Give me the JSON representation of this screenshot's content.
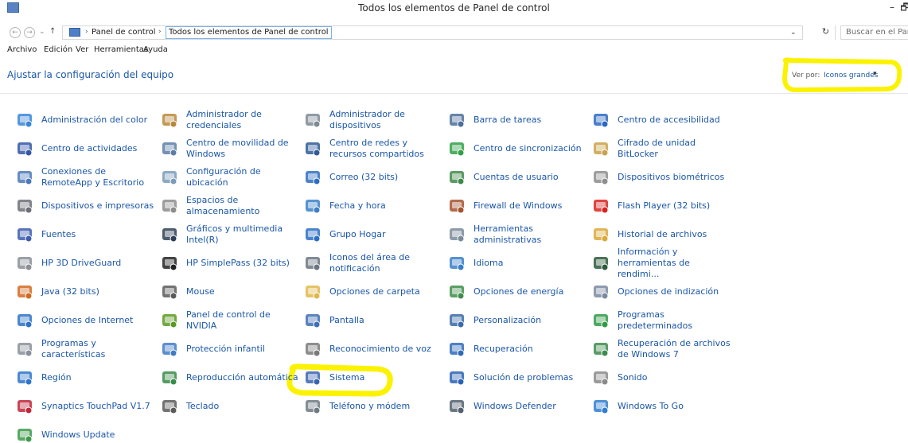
{
  "window": {
    "title": "Todos los elementos de Panel de control",
    "minimize_glyph": "–",
    "maximize_glyph": "🗗"
  },
  "address": {
    "back_glyph": "←",
    "forward_glyph": "→",
    "history_glyph": "⌄",
    "up_glyph": "↑",
    "crumbs": [
      "Panel de control",
      "Todos los elementos de Panel de control"
    ],
    "separator": "›",
    "dropdown_glyph": "⌄",
    "refresh_glyph": "↻",
    "search_placeholder": "Buscar en el Pane..."
  },
  "menu": [
    "Archivo",
    "Edición",
    "Ver",
    "Herramientas",
    "Ayuda"
  ],
  "header": {
    "title": "Ajustar la configuración del equipo",
    "view_by_label": "Ver por:",
    "view_by_value": "Iconos grandes",
    "view_by_arrow": "▾"
  },
  "highlight_color": "#fbf200",
  "link_color": "#1a56a8",
  "items": [
    {
      "label": "Administración del color",
      "icon": "color-management-icon",
      "color": "#3a86d8"
    },
    {
      "label": "Administrador de credenciales",
      "icon": "credential-manager-icon",
      "color": "#b8883a"
    },
    {
      "label": "Administrador de dispositivos",
      "icon": "device-manager-icon",
      "color": "#7d8a96"
    },
    {
      "label": "Barra de tareas",
      "icon": "taskbar-icon",
      "color": "#4a6f9a"
    },
    {
      "label": "Centro de accesibilidad",
      "icon": "accessibility-icon",
      "color": "#2a69c2"
    },
    {
      "label": "Centro de actividades",
      "icon": "action-center-flag-icon",
      "color": "#3357a6"
    },
    {
      "label": "Centro de movilidad de Windows",
      "icon": "mobility-center-icon",
      "color": "#5c7da6"
    },
    {
      "label": "Centro de redes y recursos compartidos",
      "icon": "network-center-icon",
      "color": "#2e5a96"
    },
    {
      "label": "Centro de sincronización",
      "icon": "sync-center-icon",
      "color": "#2fa046"
    },
    {
      "label": "Cifrado de unidad BitLocker",
      "icon": "bitlocker-key-icon",
      "color": "#c9a24a"
    },
    {
      "label": "Conexiones de RemoteApp y Escritorio",
      "icon": "remoteapp-icon",
      "color": "#4b78b8"
    },
    {
      "label": "Configuración de ubicación",
      "icon": "location-settings-icon",
      "color": "#7a9bb9"
    },
    {
      "label": "Correo (32 bits)",
      "icon": "mail-icon",
      "color": "#2f6dbf"
    },
    {
      "label": "Cuentas de usuario",
      "icon": "user-accounts-icon",
      "color": "#3f8a4a"
    },
    {
      "label": "Dispositivos biométricos",
      "icon": "biometric-icon",
      "color": "#8d8d8d"
    },
    {
      "label": "Dispositivos e impresoras",
      "icon": "devices-printers-icon",
      "color": "#6b6f77"
    },
    {
      "label": "Espacios de almacenamiento",
      "icon": "storage-spaces-icon",
      "color": "#8c8c8c"
    },
    {
      "label": "Fecha y hora",
      "icon": "date-time-icon",
      "color": "#3a7fc8"
    },
    {
      "label": "Firewall de Windows",
      "icon": "firewall-icon",
      "color": "#a5522d"
    },
    {
      "label": "Flash Player (32 bits)",
      "icon": "flash-player-icon",
      "color": "#d9231e"
    },
    {
      "label": "Fuentes",
      "icon": "fonts-icon",
      "color": "#3d5db0"
    },
    {
      "label": "Gráficos y multimedia Intel(R)",
      "icon": "intel-graphics-icon",
      "color": "#2f3f55"
    },
    {
      "label": "Grupo Hogar",
      "icon": "homegroup-icon",
      "color": "#2b6fc4"
    },
    {
      "label": "Herramientas administrativas",
      "icon": "admin-tools-icon",
      "color": "#7b8a99"
    },
    {
      "label": "Historial de archivos",
      "icon": "file-history-icon",
      "color": "#d9a93a"
    },
    {
      "label": "HP 3D DriveGuard",
      "icon": "hp-driveguard-icon",
      "color": "#8a8f96"
    },
    {
      "label": "HP SimplePass (32 bits)",
      "icon": "hp-simplepass-icon",
      "color": "#222222"
    },
    {
      "label": "Iconos del área de notificación",
      "icon": "notification-area-icon",
      "color": "#6a7580"
    },
    {
      "label": "Idioma",
      "icon": "language-globe-icon",
      "color": "#3a7ec8"
    },
    {
      "label": "Información y herramientas de rendimi...",
      "icon": "performance-icon",
      "color": "#2c5a3a"
    },
    {
      "label": "Java (32 bits)",
      "icon": "java-icon",
      "color": "#d2691e"
    },
    {
      "label": "Mouse",
      "icon": "mouse-icon",
      "color": "#5a5a5a"
    },
    {
      "label": "Opciones de carpeta",
      "icon": "folder-options-icon",
      "color": "#e0b84a"
    },
    {
      "label": "Opciones de energía",
      "icon": "power-options-icon",
      "color": "#3e8e4a"
    },
    {
      "label": "Opciones de indización",
      "icon": "indexing-options-icon",
      "color": "#7a8aa0"
    },
    {
      "label": "Opciones de Internet",
      "icon": "internet-options-icon",
      "color": "#2e72c6"
    },
    {
      "label": "Panel de control de NVIDIA",
      "icon": "nvidia-icon",
      "color": "#5a9a22"
    },
    {
      "label": "Pantalla",
      "icon": "display-icon",
      "color": "#3f6fb3"
    },
    {
      "label": "Personalización",
      "icon": "personalization-icon",
      "color": "#3a6aa8"
    },
    {
      "label": "Programas predeterminados",
      "icon": "default-programs-icon",
      "color": "#2f9a48"
    },
    {
      "label": "Programas y características",
      "icon": "programs-features-icon",
      "color": "#8a8f99"
    },
    {
      "label": "Protección infantil",
      "icon": "family-safety-icon",
      "color": "#3f7bc4"
    },
    {
      "label": "Reconocimiento de voz",
      "icon": "microphone-icon",
      "color": "#7a7a7a"
    },
    {
      "label": "Recuperación",
      "icon": "recovery-icon",
      "color": "#2f6ab8"
    },
    {
      "label": "Recuperación de archivos de Windows 7",
      "icon": "win7-recovery-icon",
      "color": "#3e8a4e"
    },
    {
      "label": "Región",
      "icon": "region-globe-icon",
      "color": "#2f74c9"
    },
    {
      "label": "Reproducción automática",
      "icon": "autoplay-icon",
      "color": "#3a8a48"
    },
    {
      "label": "Sistema",
      "icon": "system-icon",
      "color": "#3a64b0"
    },
    {
      "label": "Solución de problemas",
      "icon": "troubleshooting-icon",
      "color": "#2d63b4"
    },
    {
      "label": "Sonido",
      "icon": "sound-speaker-icon",
      "color": "#8a8a8a"
    },
    {
      "label": "Synaptics TouchPad V1.7",
      "icon": "synaptics-icon",
      "color": "#c0263a"
    },
    {
      "label": "Teclado",
      "icon": "keyboard-icon",
      "color": "#5a5a5a"
    },
    {
      "label": "Teléfono y módem",
      "icon": "phone-modem-icon",
      "color": "#6e7a84"
    },
    {
      "label": "Windows Defender",
      "icon": "windows-defender-icon",
      "color": "#51606e"
    },
    {
      "label": "Windows To Go",
      "icon": "windows-to-go-icon",
      "color": "#2f7ecf"
    },
    {
      "label": "Windows Update",
      "icon": "windows-update-icon",
      "color": "#3d9a4a"
    }
  ]
}
